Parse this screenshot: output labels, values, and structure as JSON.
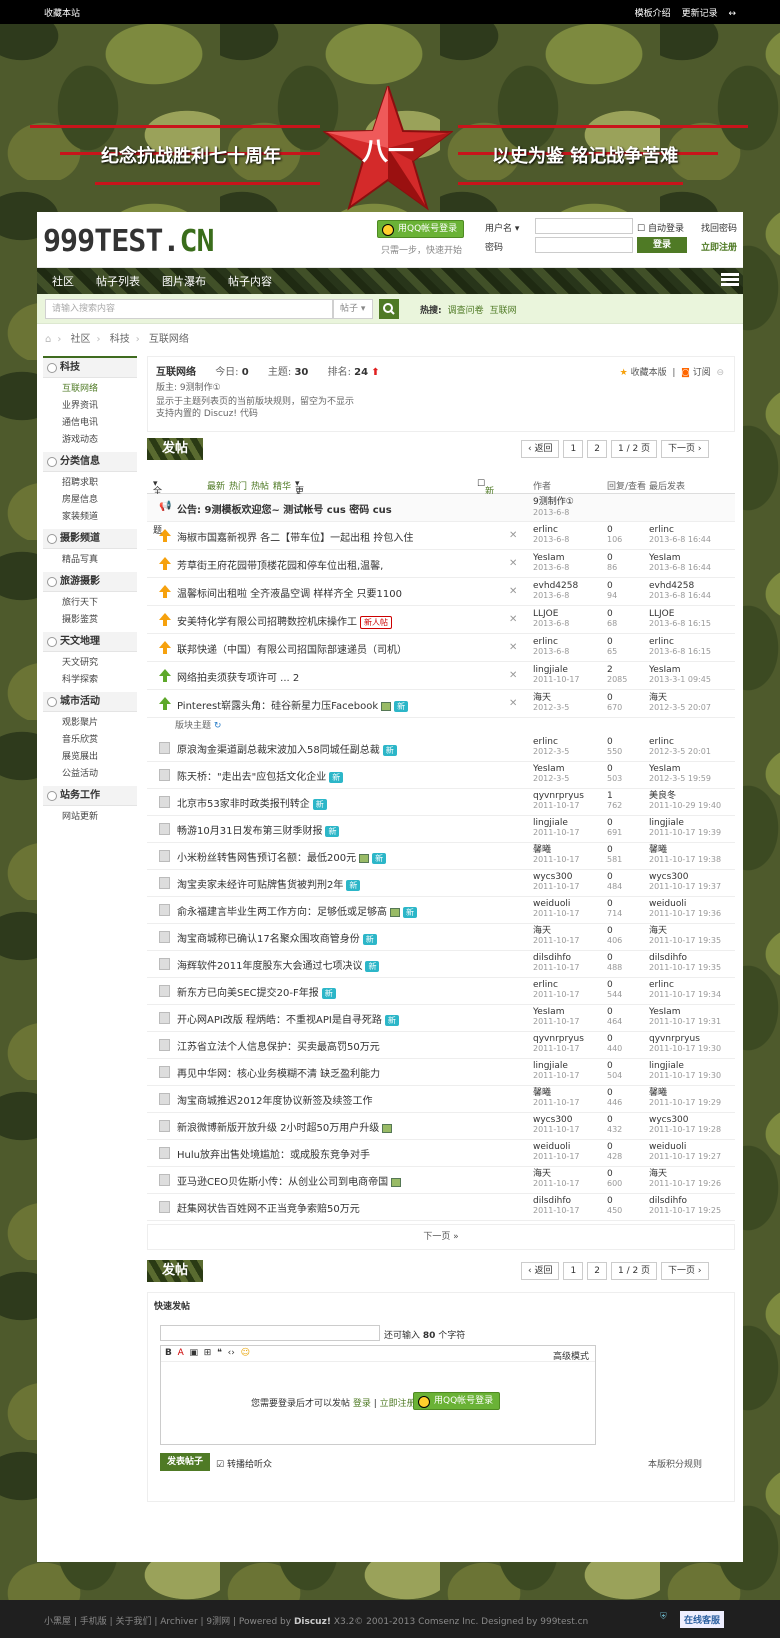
{
  "topbar": {
    "left": "收藏本站",
    "right1": "模板介绍",
    "right2": "更新记录"
  },
  "banner": {
    "left": "纪念抗战胜利七十周年",
    "right": "以史为鉴 铭记战争苦难",
    "star": "八一"
  },
  "header": {
    "logo_a": "999TEST.",
    "logo_b": "CN",
    "qq_login": "用QQ帐号登录",
    "qq_sub": "只需一步，快速开始",
    "user_label": "用户名",
    "pass_label": "密码",
    "auto": "自动登录",
    "forgot": "找回密码",
    "login": "登录",
    "register": "立即注册"
  },
  "nav": [
    "社区",
    "帖子列表",
    "图片瀑布",
    "帖子内容"
  ],
  "search": {
    "placeholder": "请输入搜索内容",
    "type": "帖子",
    "hot_label": "热搜:",
    "hot1": "调查问卷",
    "hot2": "互联网"
  },
  "crumb": [
    "社区",
    "科技",
    "互联网络"
  ],
  "sidebar": [
    {
      "g": "科技",
      "items": [
        "互联网络",
        "业界资讯",
        "通信电讯",
        "游戏动态"
      ]
    },
    {
      "g": "分类信息",
      "items": [
        "招聘求职",
        "房屋信息",
        "家装频道"
      ]
    },
    {
      "g": "摄影频道",
      "items": [
        "精品写真"
      ]
    },
    {
      "g": "旅游摄影",
      "items": [
        "旅行天下",
        "摄影鉴赏"
      ]
    },
    {
      "g": "天文地理",
      "items": [
        "天文研究",
        "科学探索"
      ]
    },
    {
      "g": "城市活动",
      "items": [
        "观影聚片",
        "音乐欣赏",
        "展览展出",
        "公益活动"
      ]
    },
    {
      "g": "站务工作",
      "items": [
        "网站更新"
      ]
    }
  ],
  "board": {
    "name": "互联网络",
    "today_l": "今日:",
    "today": "0",
    "theme_l": "主题:",
    "theme": "30",
    "rank_l": "排名:",
    "rank": "24",
    "mod": "版主: 9测制作①",
    "desc1": "显示于主题列表页的当前版块规则，留空为不显示",
    "desc2": "支持内置的 Discuz! 代码",
    "fav": "收藏本版",
    "rss": "订阅"
  },
  "post": "发帖",
  "pager": {
    "back": "返回",
    "p1": "1",
    "p2": "2",
    "cur": "1",
    "total": "/ 2 页",
    "next": "下一页"
  },
  "filter": {
    "all": "全部主题",
    "new": "最新",
    "hot": "热门",
    "hotpost": "热帖",
    "digest": "精华",
    "more": "更多",
    "newwin": "新窗",
    "author": "作者",
    "reply": "回复/查看",
    "last": "最后发表"
  },
  "announce": {
    "title": "公告: 9测模板欢迎您~ 测试帐号 cus 密码 cus",
    "author": "9测制作①",
    "date": "2013-6-8"
  },
  "sticky": [
    {
      "t": "海椒市国嘉新视界 各二【带车位】一起出租 拎包入住",
      "a": "erlinc",
      "d": "2013-6-8",
      "r": "0",
      "v": "106",
      "l": "erlinc",
      "ld": "2013-6-8 16:44"
    },
    {
      "t": "芳草街王府花园带顶楼花园和停车位出租,温馨,",
      "a": "YesIam",
      "d": "2013-6-8",
      "r": "0",
      "v": "86",
      "l": "YesIam",
      "ld": "2013-6-8 16:44"
    },
    {
      "t": "温馨标间出租啦 全齐液晶空调 样样齐全 只要1100",
      "a": "evhd4258",
      "d": "2013-6-8",
      "r": "0",
      "v": "94",
      "l": "evhd4258",
      "ld": "2013-6-8 16:44"
    },
    {
      "t": "安美特化学有限公司招聘数控机床操作工",
      "a": "LLJOE",
      "d": "2013-6-8",
      "r": "0",
      "v": "68",
      "l": "LLJOE",
      "ld": "2013-6-8 16:15",
      "tag": "新人帖"
    },
    {
      "t": "联邦快递（中国）有限公司招国际部速递员（司机）",
      "a": "erlinc",
      "d": "2013-6-8",
      "r": "0",
      "v": "65",
      "l": "erlinc",
      "ld": "2013-6-8 16:15"
    },
    {
      "t": "网络拍卖须获专项许可 ... 2",
      "a": "lingjiale",
      "d": "2011-10-17",
      "r": "2",
      "v": "2085",
      "l": "YesIam",
      "ld": "2013-3-1 09:45",
      "g": true
    },
    {
      "t": "Pinterest崭露头角：硅谷新星力压Facebook",
      "a": "海天",
      "d": "2012-3-5",
      "r": "0",
      "v": "670",
      "l": "海天",
      "ld": "2012-3-5 20:07",
      "g": true,
      "img": true,
      "new": "新"
    }
  ],
  "section": "版块主题",
  "threads": [
    {
      "t": "原浪淘金渠道副总裁宋波加入58同城任副总裁",
      "a": "erlinc",
      "d": "2012-3-5",
      "r": "0",
      "v": "550",
      "l": "erlinc",
      "ld": "2012-3-5 20:01",
      "new": "新"
    },
    {
      "t": "陈天桥：\"走出去\"应包括文化企业",
      "a": "YesIam",
      "d": "2012-3-5",
      "r": "0",
      "v": "503",
      "l": "YesIam",
      "ld": "2012-3-5 19:59",
      "new": "新"
    },
    {
      "t": "北京市53家非时政类报刊转企",
      "a": "qyvnrpryus",
      "d": "2011-10-17",
      "r": "1",
      "v": "762",
      "l": "美良冬",
      "ld": "2011-10-29 19:40",
      "new": "新"
    },
    {
      "t": "畅游10月31日发布第三财季财报",
      "a": "lingjiale",
      "d": "2011-10-17",
      "r": "0",
      "v": "691",
      "l": "lingjiale",
      "ld": "2011-10-17 19:39",
      "new": "新"
    },
    {
      "t": "小米粉丝转售网售预订名额：最低200元",
      "a": "馨曦",
      "d": "2011-10-17",
      "r": "0",
      "v": "581",
      "l": "馨曦",
      "ld": "2011-10-17 19:38",
      "img": true,
      "new": "新"
    },
    {
      "t": "淘宝卖家未经许可贴牌售货被判刑2年",
      "a": "wycs300",
      "d": "2011-10-17",
      "r": "0",
      "v": "484",
      "l": "wycs300",
      "ld": "2011-10-17 19:37",
      "new": "新"
    },
    {
      "t": "俞永福建言毕业生两工作方向：足够低或足够高",
      "a": "weiduoli",
      "d": "2011-10-17",
      "r": "0",
      "v": "714",
      "l": "weiduoli",
      "ld": "2011-10-17 19:36",
      "img": true,
      "new": "新"
    },
    {
      "t": "淘宝商城称已确认17名聚众围攻商管身份",
      "a": "海天",
      "d": "2011-10-17",
      "r": "0",
      "v": "406",
      "l": "海天",
      "ld": "2011-10-17 19:35",
      "new": "新"
    },
    {
      "t": "海辉软件2011年度股东大会通过七项决议",
      "a": "dilsdihfo",
      "d": "2011-10-17",
      "r": "0",
      "v": "488",
      "l": "dilsdihfo",
      "ld": "2011-10-17 19:35",
      "new": "新"
    },
    {
      "t": "新东方已向美SEC提交20-F年报",
      "a": "erlinc",
      "d": "2011-10-17",
      "r": "0",
      "v": "544",
      "l": "erlinc",
      "ld": "2011-10-17 19:34",
      "new": "新"
    },
    {
      "t": "开心网API改版 程炳皓：不重视API是自寻死路",
      "a": "YesIam",
      "d": "2011-10-17",
      "r": "0",
      "v": "464",
      "l": "YesIam",
      "ld": "2011-10-17 19:31",
      "new": "新"
    },
    {
      "t": "江苏省立法个人信息保护：买卖最高罚50万元",
      "a": "qyvnrpryus",
      "d": "2011-10-17",
      "r": "0",
      "v": "440",
      "l": "qyvnrpryus",
      "ld": "2011-10-17 19:30"
    },
    {
      "t": "再见中华网：核心业务模糊不清 缺乏盈利能力",
      "a": "lingjiale",
      "d": "2011-10-17",
      "r": "0",
      "v": "504",
      "l": "lingjiale",
      "ld": "2011-10-17 19:30"
    },
    {
      "t": "淘宝商城推迟2012年度协议新签及续签工作",
      "a": "馨曦",
      "d": "2011-10-17",
      "r": "0",
      "v": "446",
      "l": "馨曦",
      "ld": "2011-10-17 19:29"
    },
    {
      "t": "新浪微博新版开放升级 2小时超50万用户升级",
      "a": "wycs300",
      "d": "2011-10-17",
      "r": "0",
      "v": "432",
      "l": "wycs300",
      "ld": "2011-10-17 19:28",
      "img": true
    },
    {
      "t": "Hulu放弃出售处境尴尬：或成股东竞争对手",
      "a": "weiduoli",
      "d": "2011-10-17",
      "r": "0",
      "v": "428",
      "l": "weiduoli",
      "ld": "2011-10-17 19:27"
    },
    {
      "t": "亚马逊CEO贝佐斯小传：从创业公司到电商帝国",
      "a": "海天",
      "d": "2011-10-17",
      "r": "0",
      "v": "600",
      "l": "海天",
      "ld": "2011-10-17 19:26",
      "img": true
    },
    {
      "t": "赶集网状告百姓网不正当竞争索赔50万元",
      "a": "dilsdihfo",
      "d": "2011-10-17",
      "r": "0",
      "v": "450",
      "l": "dilsdihfo",
      "ld": "2011-10-17 19:25"
    }
  ],
  "nextpage": "下一页 »",
  "quick": {
    "title": "快速发帖",
    "remain_a": "还可输入",
    "remain_n": "80",
    "remain_b": "个字符",
    "adv": "高级模式",
    "need": "您需要登录后才可以发帖",
    "login": "登录",
    "reg": "立即注册",
    "qq": "用QQ帐号登录",
    "submit": "发表帖子",
    "bcast": "转播给听众",
    "rule": "本版积分规则"
  },
  "footer": {
    "links": "小黑屋 | 手机版 | 关于我们 | Archiver | 9测网 |",
    "pow": "Powered by",
    "dz": "Discuz!",
    "rest": "X3.2© 2001-2013 Comsenz Inc. Designed by 999test.cn",
    "online": "在线客服"
  }
}
